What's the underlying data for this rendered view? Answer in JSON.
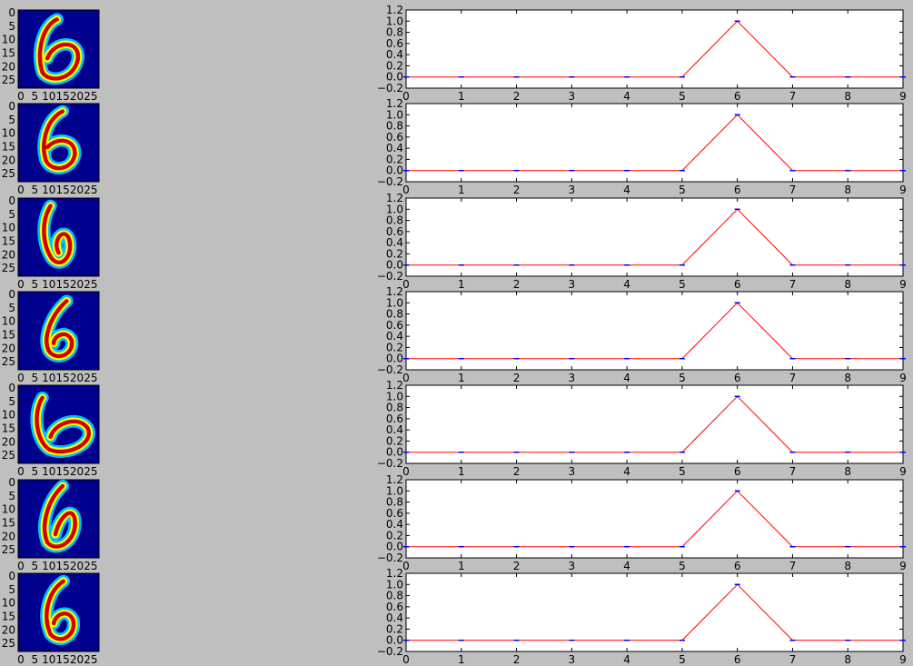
{
  "chart_data": [
    {
      "type": "heatmap",
      "description_label": "6",
      "xticks": [
        "0",
        "5",
        "10",
        "15",
        "20",
        "25"
      ],
      "yticks": [
        "0",
        "5",
        "10",
        "15",
        "20",
        "25"
      ],
      "xlim": [
        0,
        27
      ],
      "ylim": [
        0,
        27
      ]
    },
    {
      "type": "line",
      "x": [
        0,
        1,
        2,
        3,
        4,
        5,
        6,
        7,
        8,
        9
      ],
      "series": [
        {
          "values": [
            0,
            0,
            0,
            0,
            0,
            0,
            1,
            0,
            0,
            0
          ]
        }
      ],
      "xlim": [
        0,
        9
      ],
      "ylim": [
        -0.2,
        1.2
      ],
      "xticks": [
        "0",
        "1",
        "2",
        "3",
        "4",
        "5",
        "6",
        "7",
        "8",
        "9"
      ],
      "yticks": [
        "−0.2",
        "0.0",
        "0.2",
        "0.4",
        "0.6",
        "0.8",
        "1.0",
        "1.2"
      ],
      "yticks_first_row": [
        "−0.2",
        "0.0",
        "0.2",
        "0.4",
        "0.6",
        "0.8",
        "1.0",
        "1.2"
      ],
      "yticks_other_rows": [
        "−0.2",
        "0.0",
        "0.2",
        "0.4",
        "0.6",
        "0.8",
        "1.0",
        "1.2"
      ]
    }
  ],
  "rows": 7,
  "colors": {
    "background": "#bfbfbf",
    "line": "#ff0000",
    "marker": "#0000ff",
    "heatmap_bg": "#00008f"
  }
}
